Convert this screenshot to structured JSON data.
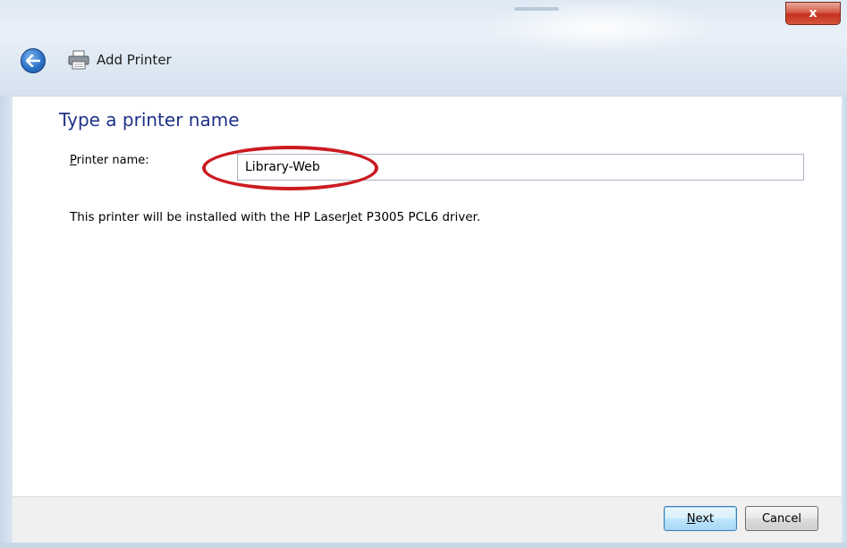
{
  "window": {
    "title": "Add Printer",
    "close_label": "x"
  },
  "page": {
    "heading": "Type a printer name",
    "printer_name": {
      "label_underlined": "P",
      "label_rest": "rinter name:",
      "value": "Library-Web"
    },
    "driver_info": "This printer will be installed with the HP LaserJet P3005 PCL6 driver."
  },
  "buttons": {
    "next_underlined": "N",
    "next_rest": "ext",
    "cancel": "Cancel"
  },
  "colors": {
    "heading": "#1e3287",
    "highlight_circle": "#cc1b22",
    "close_button": "#c3311e"
  }
}
